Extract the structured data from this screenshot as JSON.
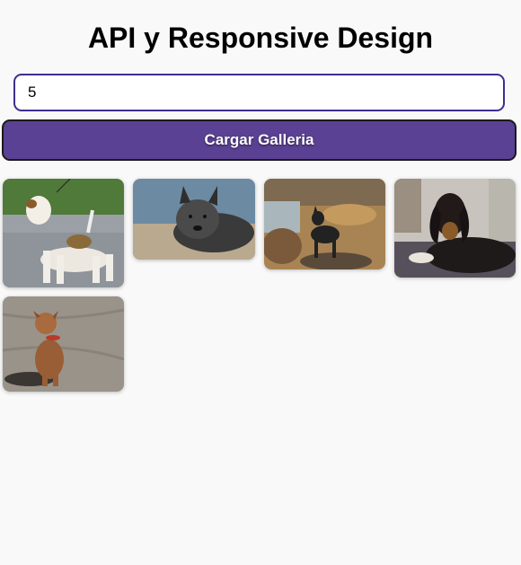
{
  "page": {
    "title": "API y Responsive Design"
  },
  "controls": {
    "count_value": "5",
    "load_button_label": "Cargar Galleria"
  },
  "gallery": {
    "images": [
      {
        "subject": "wire fox terrier dog"
      },
      {
        "subject": "grey scottish terrier dog"
      },
      {
        "subject": "black dog on rocky beach"
      },
      {
        "subject": "black and tan coonhound dog"
      },
      {
        "subject": "brown dog sitting on sand"
      }
    ]
  },
  "colors": {
    "background": "#f9f9f9",
    "button": "#5b4193",
    "input_border": "#3b2f8f"
  }
}
